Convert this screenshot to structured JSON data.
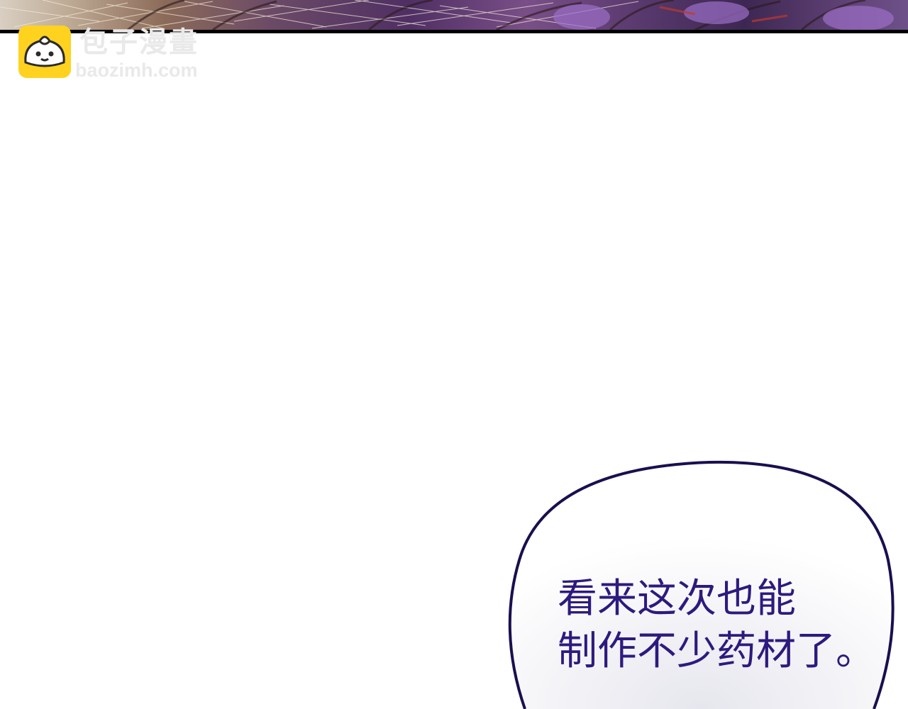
{
  "watermark": {
    "title": "包子漫畫",
    "url": "baozimh.com",
    "logo_icon": "steamed-bun-icon",
    "logo_color": "#ffd21f",
    "text_color": "#e9e9e9"
  },
  "speech_bubble": {
    "lines": [
      "看来这次也能",
      "制作不少药材了。"
    ],
    "text_color": "#2e1a7e",
    "outline_color": "#1a0f4f"
  }
}
